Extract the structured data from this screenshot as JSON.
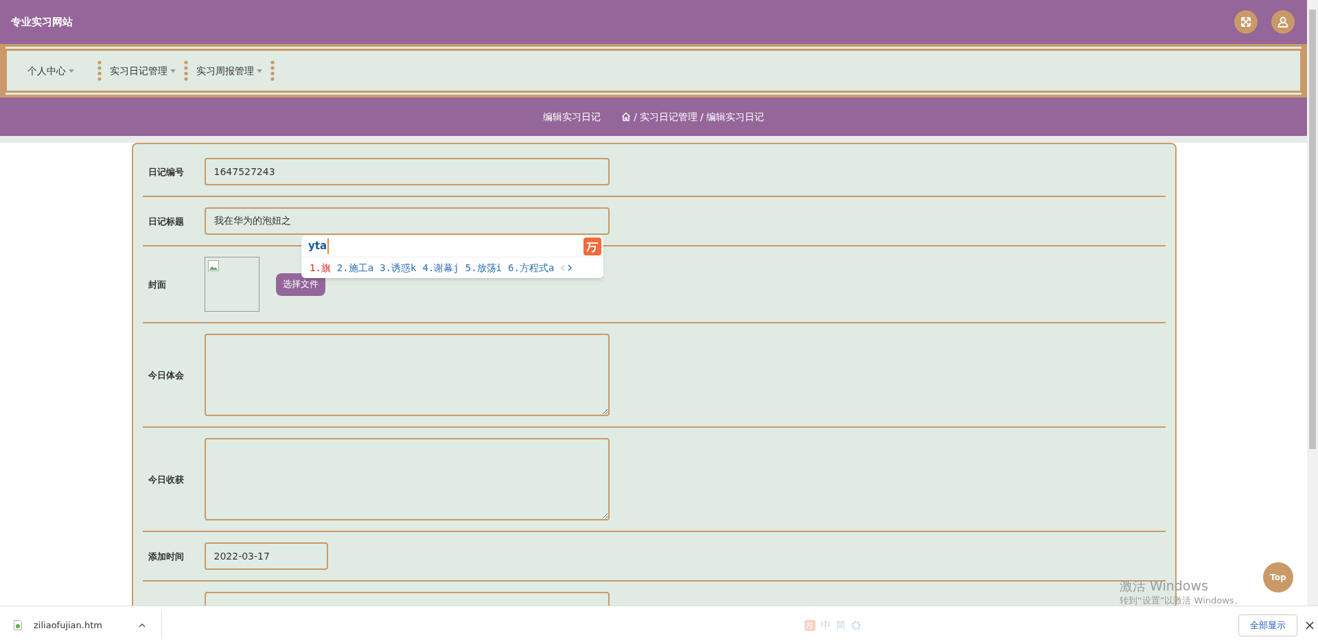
{
  "header": {
    "title": "专业实习网站"
  },
  "nav": [
    {
      "label": "个人中心"
    },
    {
      "label": "实习日记管理"
    },
    {
      "label": "实习周报管理"
    }
  ],
  "breadcrumb": {
    "page_title": "编辑实习日记",
    "separator": "/",
    "path": [
      "实习日记管理",
      "编辑实习日记"
    ]
  },
  "form": {
    "fields": [
      {
        "kind": "input",
        "label": "日记编号",
        "value": "1647527243"
      },
      {
        "kind": "input",
        "label": "日记标题",
        "value": "我在华为的泡妞之"
      },
      {
        "kind": "image",
        "label": "封面",
        "button": "选择文件"
      },
      {
        "kind": "textarea",
        "label": "今日体会"
      },
      {
        "kind": "textarea",
        "label": "今日收获"
      },
      {
        "kind": "date",
        "label": "添加时间",
        "value": "2022-03-17"
      },
      {
        "kind": "input"
      }
    ]
  },
  "ime": {
    "composition": "yta",
    "candidates": [
      {
        "text": "1.旗",
        "selected": true
      },
      {
        "text": "2.施工a",
        "selected": false
      },
      {
        "text": "3.诱惑k",
        "selected": false
      },
      {
        "text": "4.谢幕j",
        "selected": false
      },
      {
        "text": "5.放荡i",
        "selected": false
      },
      {
        "text": "6.方程式a",
        "selected": false
      }
    ]
  },
  "ime_status": {
    "items": [
      "中",
      "简"
    ]
  },
  "top_button": "Top",
  "activation_notice": {
    "title": "激活 Windows",
    "subtitle": "转到“设置”以激活 Windows。"
  },
  "download_bar": {
    "file": "ziliaofujian.htm",
    "show_all": "全部显示"
  }
}
